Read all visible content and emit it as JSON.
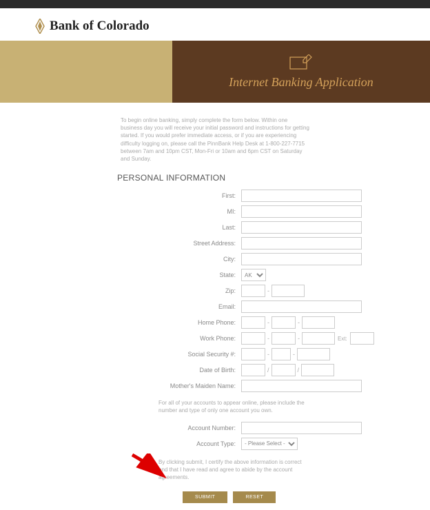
{
  "brand": "Bank of Colorado",
  "hero_title": "Internet Banking Application",
  "intro": "To begin online banking, simply complete the form below. Within one business day you will receive your initial password and instructions for getting started. If you would prefer immediate access, or if you are experiencing difficulty logging on, please call the PinnBank Help Desk at 1-800-227-7715 between 7am and 10pm CST, Mon-Fri or 10am and 6pm CST on Saturday and Sunday.",
  "section_title": "PERSONAL INFORMATION",
  "labels": {
    "first": "First:",
    "mi": "MI:",
    "last": "Last:",
    "street": "Street Address:",
    "city": "City:",
    "state": "State:",
    "zip": "Zip:",
    "email": "Email:",
    "home_phone": "Home Phone:",
    "work_phone": "Work Phone:",
    "ssn": "Social Security #:",
    "dob": "Date of Birth:",
    "maiden": "Mother's Maiden Name:",
    "account_number": "Account Number:",
    "account_type": "Account Type:",
    "ext": "Ext:"
  },
  "state_selected": "AK",
  "account_type_placeholder": "- Please Select -",
  "note": "For all of your accounts to appear online, please include the number and type of only one account you own.",
  "disclaimer": "By clicking submit, I certify the above information is correct and that I have read and agree to abide by the account agreements.",
  "buttons": {
    "submit": "SUBMIT",
    "reset": "RESET"
  }
}
